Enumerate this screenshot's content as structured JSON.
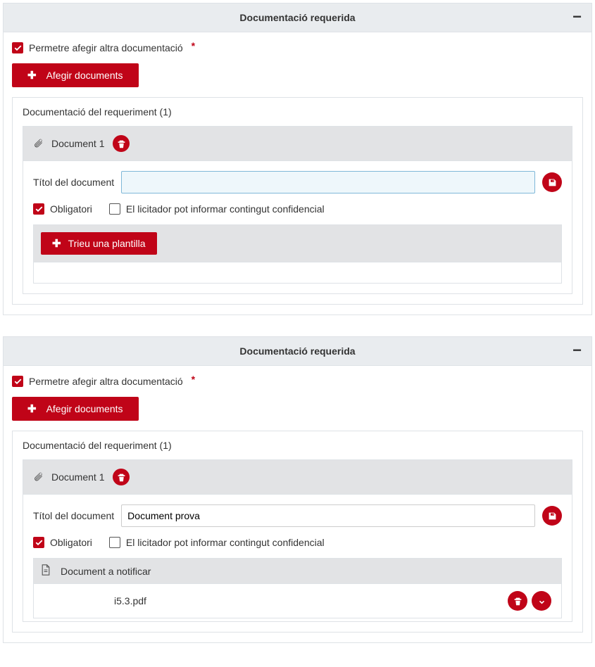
{
  "panel1": {
    "title": "Documentació requerida",
    "collapse_symbol": "−",
    "allow_other_docs_label": "Permetre afegir altra documentació",
    "add_docs_btn": "Afegir documents",
    "req_docs_title": "Documentació del requeriment (1)",
    "doc1_label": "Document 1",
    "field_title_label": "Títol del document",
    "title_value": "",
    "obligatory_label": "Obligatori",
    "confidential_label": "El licitador pot informar contingut confidencial",
    "choose_template_btn": "Trieu una plantilla"
  },
  "panel2": {
    "title": "Documentació requerida",
    "collapse_symbol": "−",
    "allow_other_docs_label": "Permetre afegir altra documentació",
    "add_docs_btn": "Afegir documents",
    "req_docs_title": "Documentació del requeriment (1)",
    "doc1_label": "Document 1",
    "field_title_label": "Títol del document",
    "title_value": "Document prova",
    "obligatory_label": "Obligatori",
    "confidential_label": "El licitador pot informar contingut confidencial",
    "notify_header": "Document a notificar",
    "file_name": "i5.3.pdf"
  }
}
